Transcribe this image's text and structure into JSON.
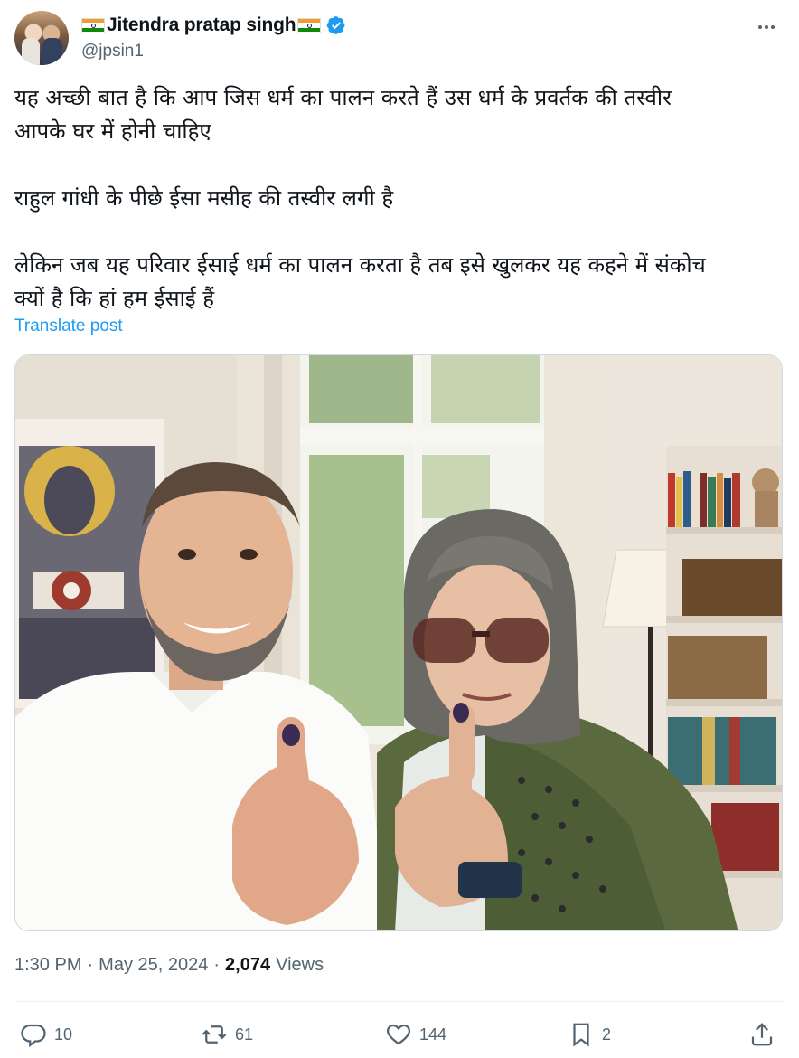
{
  "author": {
    "display_name": "Jitendra pratap singh",
    "handle": "@jpsin1",
    "verified_icon": "verified-badge-icon",
    "verified_color": "#1d9bf0",
    "avatar_icon": "avatar"
  },
  "post": {
    "lines": [
      "यह अच्छी बात है कि आप जिस धर्म का पालन करते हैं उस धर्म के प्रवर्तक की तस्वीर",
      "आपके घर में होनी चाहिए",
      "राहुल गांधी के पीछे ईसा मसीह की तस्वीर लगी है",
      "लेकिन जब यह परिवार ईसाई धर्म का पालन करता है तब इसे खुलकर यह कहने में संकोच",
      "क्यों है कि हां हम ईसाई  हैं"
    ],
    "translate_label": "Translate post"
  },
  "meta": {
    "time": "1:30 PM",
    "separator": "·",
    "date": "May 25, 2024",
    "views_count": "2,074",
    "views_label": "Views"
  },
  "actions": {
    "replies": "10",
    "reposts": "61",
    "likes": "144",
    "bookmarks": "2"
  },
  "colors": {
    "accent": "#1d9bf0",
    "secondary_text": "#536471",
    "primary_text": "#0f1419"
  }
}
